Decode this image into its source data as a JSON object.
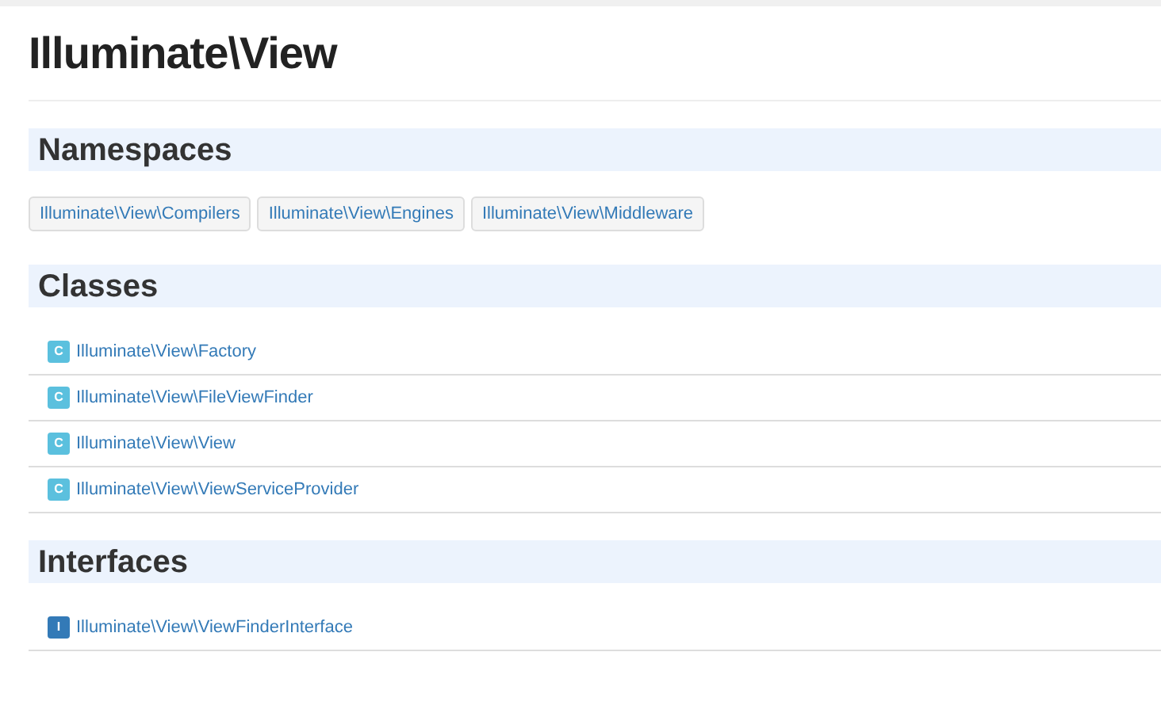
{
  "title": "Illuminate\\View",
  "namespaces": {
    "heading": "Namespaces",
    "items": [
      "Illuminate\\View\\Compilers",
      "Illuminate\\View\\Engines",
      "Illuminate\\View\\Middleware"
    ]
  },
  "classes": {
    "heading": "Classes",
    "items": [
      {
        "kind": "class",
        "badge": "C",
        "name": "Illuminate\\View\\Factory"
      },
      {
        "kind": "class",
        "badge": "C",
        "name": "Illuminate\\View\\FileViewFinder"
      },
      {
        "kind": "class",
        "badge": "C",
        "name": "Illuminate\\View\\View"
      },
      {
        "kind": "class",
        "badge": "C",
        "name": "Illuminate\\View\\ViewServiceProvider"
      }
    ]
  },
  "interfaces": {
    "heading": "Interfaces",
    "items": [
      {
        "kind": "interface",
        "badge": "I",
        "name": "Illuminate\\View\\ViewFinderInterface"
      }
    ]
  }
}
